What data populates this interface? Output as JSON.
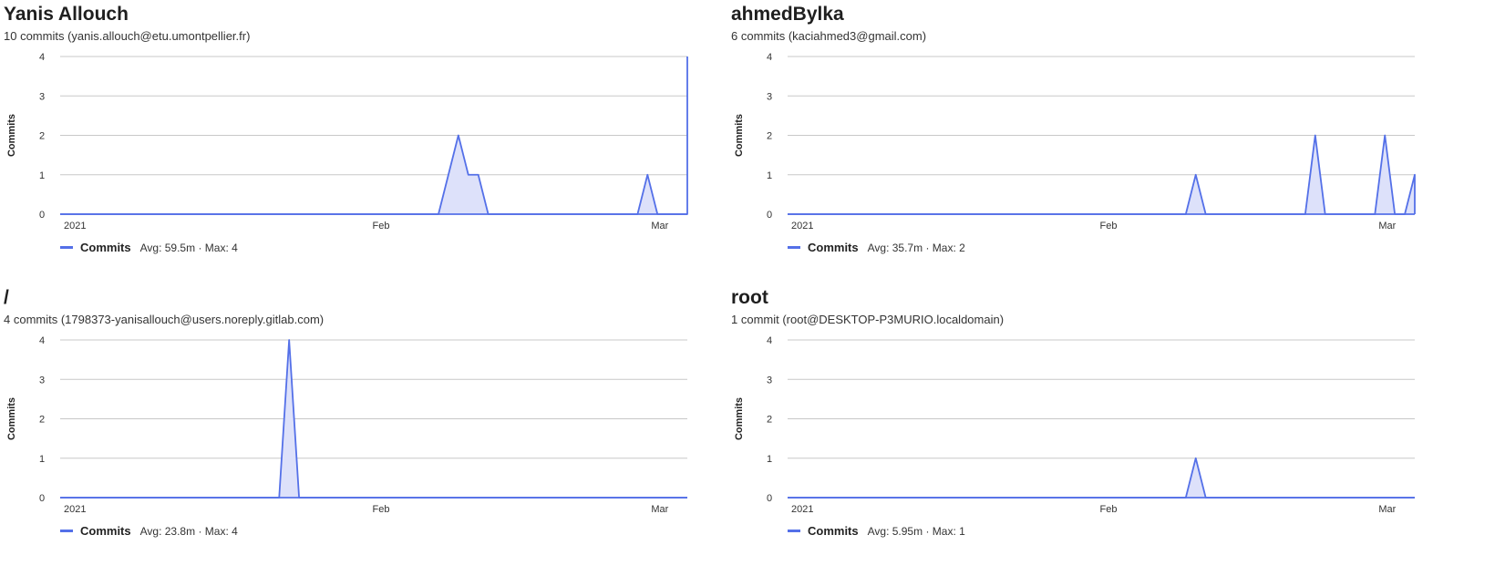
{
  "colors": {
    "line": "#5470e8",
    "area": "#dde1fa",
    "grid": "#c8c8c8"
  },
  "chart_data": [
    {
      "type": "area",
      "title": "Yanis Allouch",
      "subtitle": "10 commits (yanis.allouch@etu.umontpellier.fr)",
      "ylabel": "Commits",
      "ylim": [
        0,
        4
      ],
      "yticks": [
        "0",
        "1",
        "2",
        "3",
        "4"
      ],
      "xlim": [
        "2021-01-01",
        "2021-03-05"
      ],
      "xticks": [
        {
          "date": "2021-01-01",
          "label": "2021"
        },
        {
          "date": "2021-02-01",
          "label": "Feb"
        },
        {
          "date": "2021-03-01",
          "label": "Mar"
        }
      ],
      "grid": true,
      "legend": {
        "name": "Commits",
        "stats": "Avg: 59.5m · Max: 4"
      },
      "series": [
        {
          "name": "Commits",
          "points": [
            [
              "2021-01-01",
              0
            ],
            [
              "2021-02-08",
              0
            ],
            [
              "2021-02-10",
              2
            ],
            [
              "2021-02-11",
              1
            ],
            [
              "2021-02-12",
              1
            ],
            [
              "2021-02-13",
              0
            ],
            [
              "2021-02-28",
              0
            ],
            [
              "2021-03-01",
              1
            ],
            [
              "2021-03-02",
              0
            ],
            [
              "2021-03-05",
              0
            ],
            [
              "2021-03-05",
              4
            ]
          ]
        }
      ]
    },
    {
      "type": "area",
      "title": "ahmedBylka",
      "subtitle": "6 commits (kaciahmed3@gmail.com)",
      "ylabel": "Commits",
      "ylim": [
        0,
        4
      ],
      "yticks": [
        "0",
        "1",
        "2",
        "3",
        "4"
      ],
      "xlim": [
        "2021-01-01",
        "2021-03-05"
      ],
      "xticks": [
        {
          "date": "2021-01-01",
          "label": "2021"
        },
        {
          "date": "2021-02-01",
          "label": "Feb"
        },
        {
          "date": "2021-03-01",
          "label": "Mar"
        }
      ],
      "grid": true,
      "legend": {
        "name": "Commits",
        "stats": "Avg: 35.7m · Max: 2"
      },
      "series": [
        {
          "name": "Commits",
          "points": [
            [
              "2021-01-01",
              0
            ],
            [
              "2021-02-10",
              0
            ],
            [
              "2021-02-11",
              1
            ],
            [
              "2021-02-12",
              0
            ],
            [
              "2021-02-22",
              0
            ],
            [
              "2021-02-23",
              2
            ],
            [
              "2021-02-24",
              0
            ],
            [
              "2021-03-01",
              0
            ],
            [
              "2021-03-02",
              2
            ],
            [
              "2021-03-03",
              0
            ],
            [
              "2021-03-04",
              0
            ],
            [
              "2021-03-05",
              1
            ],
            [
              "2021-03-06",
              0
            ]
          ]
        }
      ]
    },
    {
      "type": "area",
      "title": "/",
      "subtitle": "4 commits (1798373-yanisallouch@users.noreply.gitlab.com)",
      "ylabel": "Commits",
      "ylim": [
        0,
        4
      ],
      "yticks": [
        "0",
        "1",
        "2",
        "3",
        "4"
      ],
      "xlim": [
        "2021-01-01",
        "2021-03-05"
      ],
      "xticks": [
        {
          "date": "2021-01-01",
          "label": "2021"
        },
        {
          "date": "2021-02-01",
          "label": "Feb"
        },
        {
          "date": "2021-03-01",
          "label": "Mar"
        }
      ],
      "grid": true,
      "legend": {
        "name": "Commits",
        "stats": "Avg: 23.8m · Max: 4"
      },
      "series": [
        {
          "name": "Commits",
          "points": [
            [
              "2021-01-01",
              0
            ],
            [
              "2021-01-23",
              0
            ],
            [
              "2021-01-24",
              4
            ],
            [
              "2021-01-25",
              0
            ],
            [
              "2021-03-05",
              0
            ]
          ]
        }
      ]
    },
    {
      "type": "area",
      "title": "root",
      "subtitle": "1 commit (root@DESKTOP-P3MURIO.localdomain)",
      "ylabel": "Commits",
      "ylim": [
        0,
        4
      ],
      "yticks": [
        "0",
        "1",
        "2",
        "3",
        "4"
      ],
      "xlim": [
        "2021-01-01",
        "2021-03-05"
      ],
      "xticks": [
        {
          "date": "2021-01-01",
          "label": "2021"
        },
        {
          "date": "2021-02-01",
          "label": "Feb"
        },
        {
          "date": "2021-03-01",
          "label": "Mar"
        }
      ],
      "grid": true,
      "legend": {
        "name": "Commits",
        "stats": "Avg: 5.95m · Max: 1"
      },
      "series": [
        {
          "name": "Commits",
          "points": [
            [
              "2021-01-01",
              0
            ],
            [
              "2021-02-10",
              0
            ],
            [
              "2021-02-11",
              1
            ],
            [
              "2021-02-12",
              0
            ],
            [
              "2021-03-05",
              0
            ]
          ]
        }
      ]
    }
  ]
}
